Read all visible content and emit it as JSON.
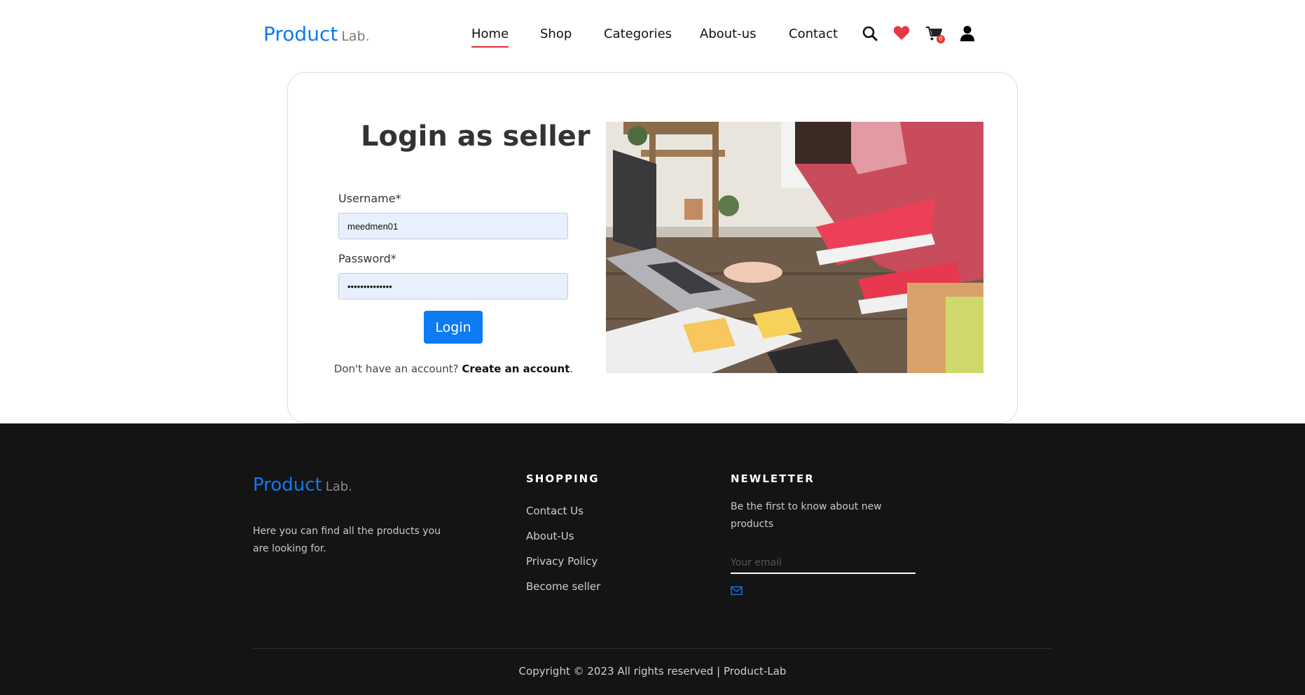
{
  "header": {
    "brand": {
      "main": "Product",
      "sub": "Lab."
    },
    "nav": [
      {
        "label": "Home",
        "active": true
      },
      {
        "label": "Shop"
      },
      {
        "label": "Categories"
      },
      {
        "label": "About-us"
      },
      {
        "label": "Contact"
      }
    ],
    "icons": [
      "search-icon",
      "heart-icon",
      "cart-icon",
      "user-icon"
    ],
    "cart_count": "0"
  },
  "login": {
    "title": "Login as seller",
    "username_label": "Username*",
    "username_value": "meedmen01",
    "password_label": "Password*",
    "password_value": "••••••••••••••",
    "button_label": "Login",
    "account_prompt": "Don't have an account?",
    "create_account_label": "Create an account",
    "trailing_period": "."
  },
  "footer": {
    "brand": {
      "main": "Product",
      "sub": "Lab."
    },
    "description": "Here you can find all the products you are looking for.",
    "shopping": {
      "heading": "SHOPPING",
      "links": [
        "Contact Us",
        "About-Us",
        "Privacy Policy",
        "Become seller"
      ]
    },
    "newsletter": {
      "heading": "NEWLETTER",
      "description": "Be the first to know about new products",
      "placeholder": "Your email"
    },
    "copyright": "Copyright © 2023 All rights reserved | Product-Lab"
  },
  "colors": {
    "accent": "#0d7bf2",
    "nav_underline": "#e52b3a",
    "heart": "#e53945",
    "badge": "#e53935",
    "footer_bg": "#141414",
    "input_bg": "#e8effd"
  }
}
